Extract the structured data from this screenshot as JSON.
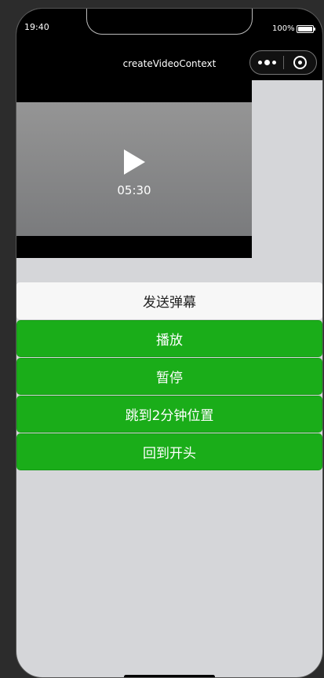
{
  "status_bar": {
    "time": "19:40",
    "battery": "100%"
  },
  "nav": {
    "title": "createVideoContext"
  },
  "video": {
    "duration": "05:30"
  },
  "buttons": {
    "send_danmu": "发送弹幕",
    "play": "播放",
    "pause": "暂停",
    "seek": "跳到2分钟位置",
    "restart": "回到开头"
  },
  "colors": {
    "primary_button": "#1aad19",
    "background": "#d5d6d9"
  }
}
